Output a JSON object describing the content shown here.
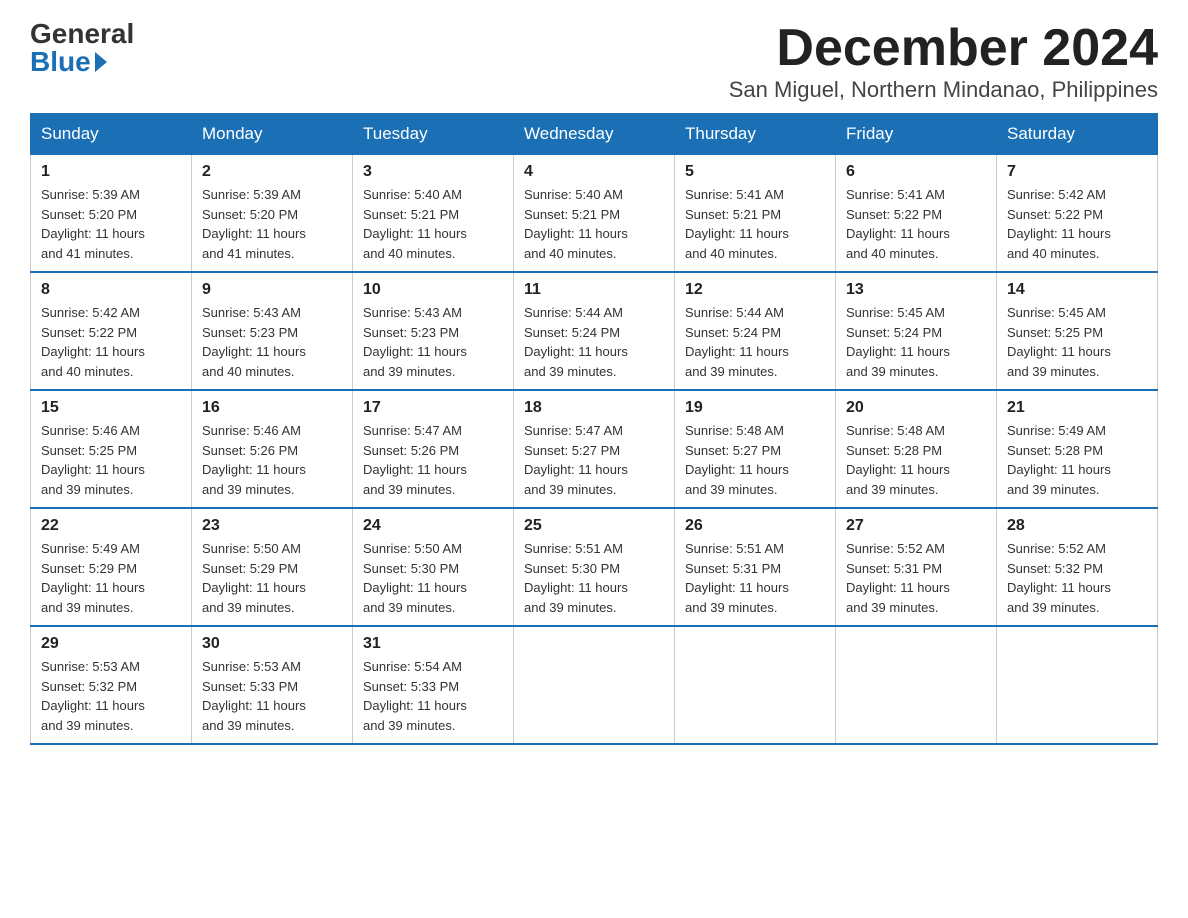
{
  "logo": {
    "general": "General",
    "blue": "Blue"
  },
  "title": "December 2024",
  "subtitle": "San Miguel, Northern Mindanao, Philippines",
  "headers": [
    "Sunday",
    "Monday",
    "Tuesday",
    "Wednesday",
    "Thursday",
    "Friday",
    "Saturday"
  ],
  "weeks": [
    [
      {
        "day": "1",
        "sunrise": "5:39 AM",
        "sunset": "5:20 PM",
        "daylight": "11 hours and 41 minutes."
      },
      {
        "day": "2",
        "sunrise": "5:39 AM",
        "sunset": "5:20 PM",
        "daylight": "11 hours and 41 minutes."
      },
      {
        "day": "3",
        "sunrise": "5:40 AM",
        "sunset": "5:21 PM",
        "daylight": "11 hours and 40 minutes."
      },
      {
        "day": "4",
        "sunrise": "5:40 AM",
        "sunset": "5:21 PM",
        "daylight": "11 hours and 40 minutes."
      },
      {
        "day": "5",
        "sunrise": "5:41 AM",
        "sunset": "5:21 PM",
        "daylight": "11 hours and 40 minutes."
      },
      {
        "day": "6",
        "sunrise": "5:41 AM",
        "sunset": "5:22 PM",
        "daylight": "11 hours and 40 minutes."
      },
      {
        "day": "7",
        "sunrise": "5:42 AM",
        "sunset": "5:22 PM",
        "daylight": "11 hours and 40 minutes."
      }
    ],
    [
      {
        "day": "8",
        "sunrise": "5:42 AM",
        "sunset": "5:22 PM",
        "daylight": "11 hours and 40 minutes."
      },
      {
        "day": "9",
        "sunrise": "5:43 AM",
        "sunset": "5:23 PM",
        "daylight": "11 hours and 40 minutes."
      },
      {
        "day": "10",
        "sunrise": "5:43 AM",
        "sunset": "5:23 PM",
        "daylight": "11 hours and 39 minutes."
      },
      {
        "day": "11",
        "sunrise": "5:44 AM",
        "sunset": "5:24 PM",
        "daylight": "11 hours and 39 minutes."
      },
      {
        "day": "12",
        "sunrise": "5:44 AM",
        "sunset": "5:24 PM",
        "daylight": "11 hours and 39 minutes."
      },
      {
        "day": "13",
        "sunrise": "5:45 AM",
        "sunset": "5:24 PM",
        "daylight": "11 hours and 39 minutes."
      },
      {
        "day": "14",
        "sunrise": "5:45 AM",
        "sunset": "5:25 PM",
        "daylight": "11 hours and 39 minutes."
      }
    ],
    [
      {
        "day": "15",
        "sunrise": "5:46 AM",
        "sunset": "5:25 PM",
        "daylight": "11 hours and 39 minutes."
      },
      {
        "day": "16",
        "sunrise": "5:46 AM",
        "sunset": "5:26 PM",
        "daylight": "11 hours and 39 minutes."
      },
      {
        "day": "17",
        "sunrise": "5:47 AM",
        "sunset": "5:26 PM",
        "daylight": "11 hours and 39 minutes."
      },
      {
        "day": "18",
        "sunrise": "5:47 AM",
        "sunset": "5:27 PM",
        "daylight": "11 hours and 39 minutes."
      },
      {
        "day": "19",
        "sunrise": "5:48 AM",
        "sunset": "5:27 PM",
        "daylight": "11 hours and 39 minutes."
      },
      {
        "day": "20",
        "sunrise": "5:48 AM",
        "sunset": "5:28 PM",
        "daylight": "11 hours and 39 minutes."
      },
      {
        "day": "21",
        "sunrise": "5:49 AM",
        "sunset": "5:28 PM",
        "daylight": "11 hours and 39 minutes."
      }
    ],
    [
      {
        "day": "22",
        "sunrise": "5:49 AM",
        "sunset": "5:29 PM",
        "daylight": "11 hours and 39 minutes."
      },
      {
        "day": "23",
        "sunrise": "5:50 AM",
        "sunset": "5:29 PM",
        "daylight": "11 hours and 39 minutes."
      },
      {
        "day": "24",
        "sunrise": "5:50 AM",
        "sunset": "5:30 PM",
        "daylight": "11 hours and 39 minutes."
      },
      {
        "day": "25",
        "sunrise": "5:51 AM",
        "sunset": "5:30 PM",
        "daylight": "11 hours and 39 minutes."
      },
      {
        "day": "26",
        "sunrise": "5:51 AM",
        "sunset": "5:31 PM",
        "daylight": "11 hours and 39 minutes."
      },
      {
        "day": "27",
        "sunrise": "5:52 AM",
        "sunset": "5:31 PM",
        "daylight": "11 hours and 39 minutes."
      },
      {
        "day": "28",
        "sunrise": "5:52 AM",
        "sunset": "5:32 PM",
        "daylight": "11 hours and 39 minutes."
      }
    ],
    [
      {
        "day": "29",
        "sunrise": "5:53 AM",
        "sunset": "5:32 PM",
        "daylight": "11 hours and 39 minutes."
      },
      {
        "day": "30",
        "sunrise": "5:53 AM",
        "sunset": "5:33 PM",
        "daylight": "11 hours and 39 minutes."
      },
      {
        "day": "31",
        "sunrise": "5:54 AM",
        "sunset": "5:33 PM",
        "daylight": "11 hours and 39 minutes."
      },
      null,
      null,
      null,
      null
    ]
  ],
  "labels": {
    "sunrise": "Sunrise:",
    "sunset": "Sunset:",
    "daylight": "Daylight:"
  }
}
